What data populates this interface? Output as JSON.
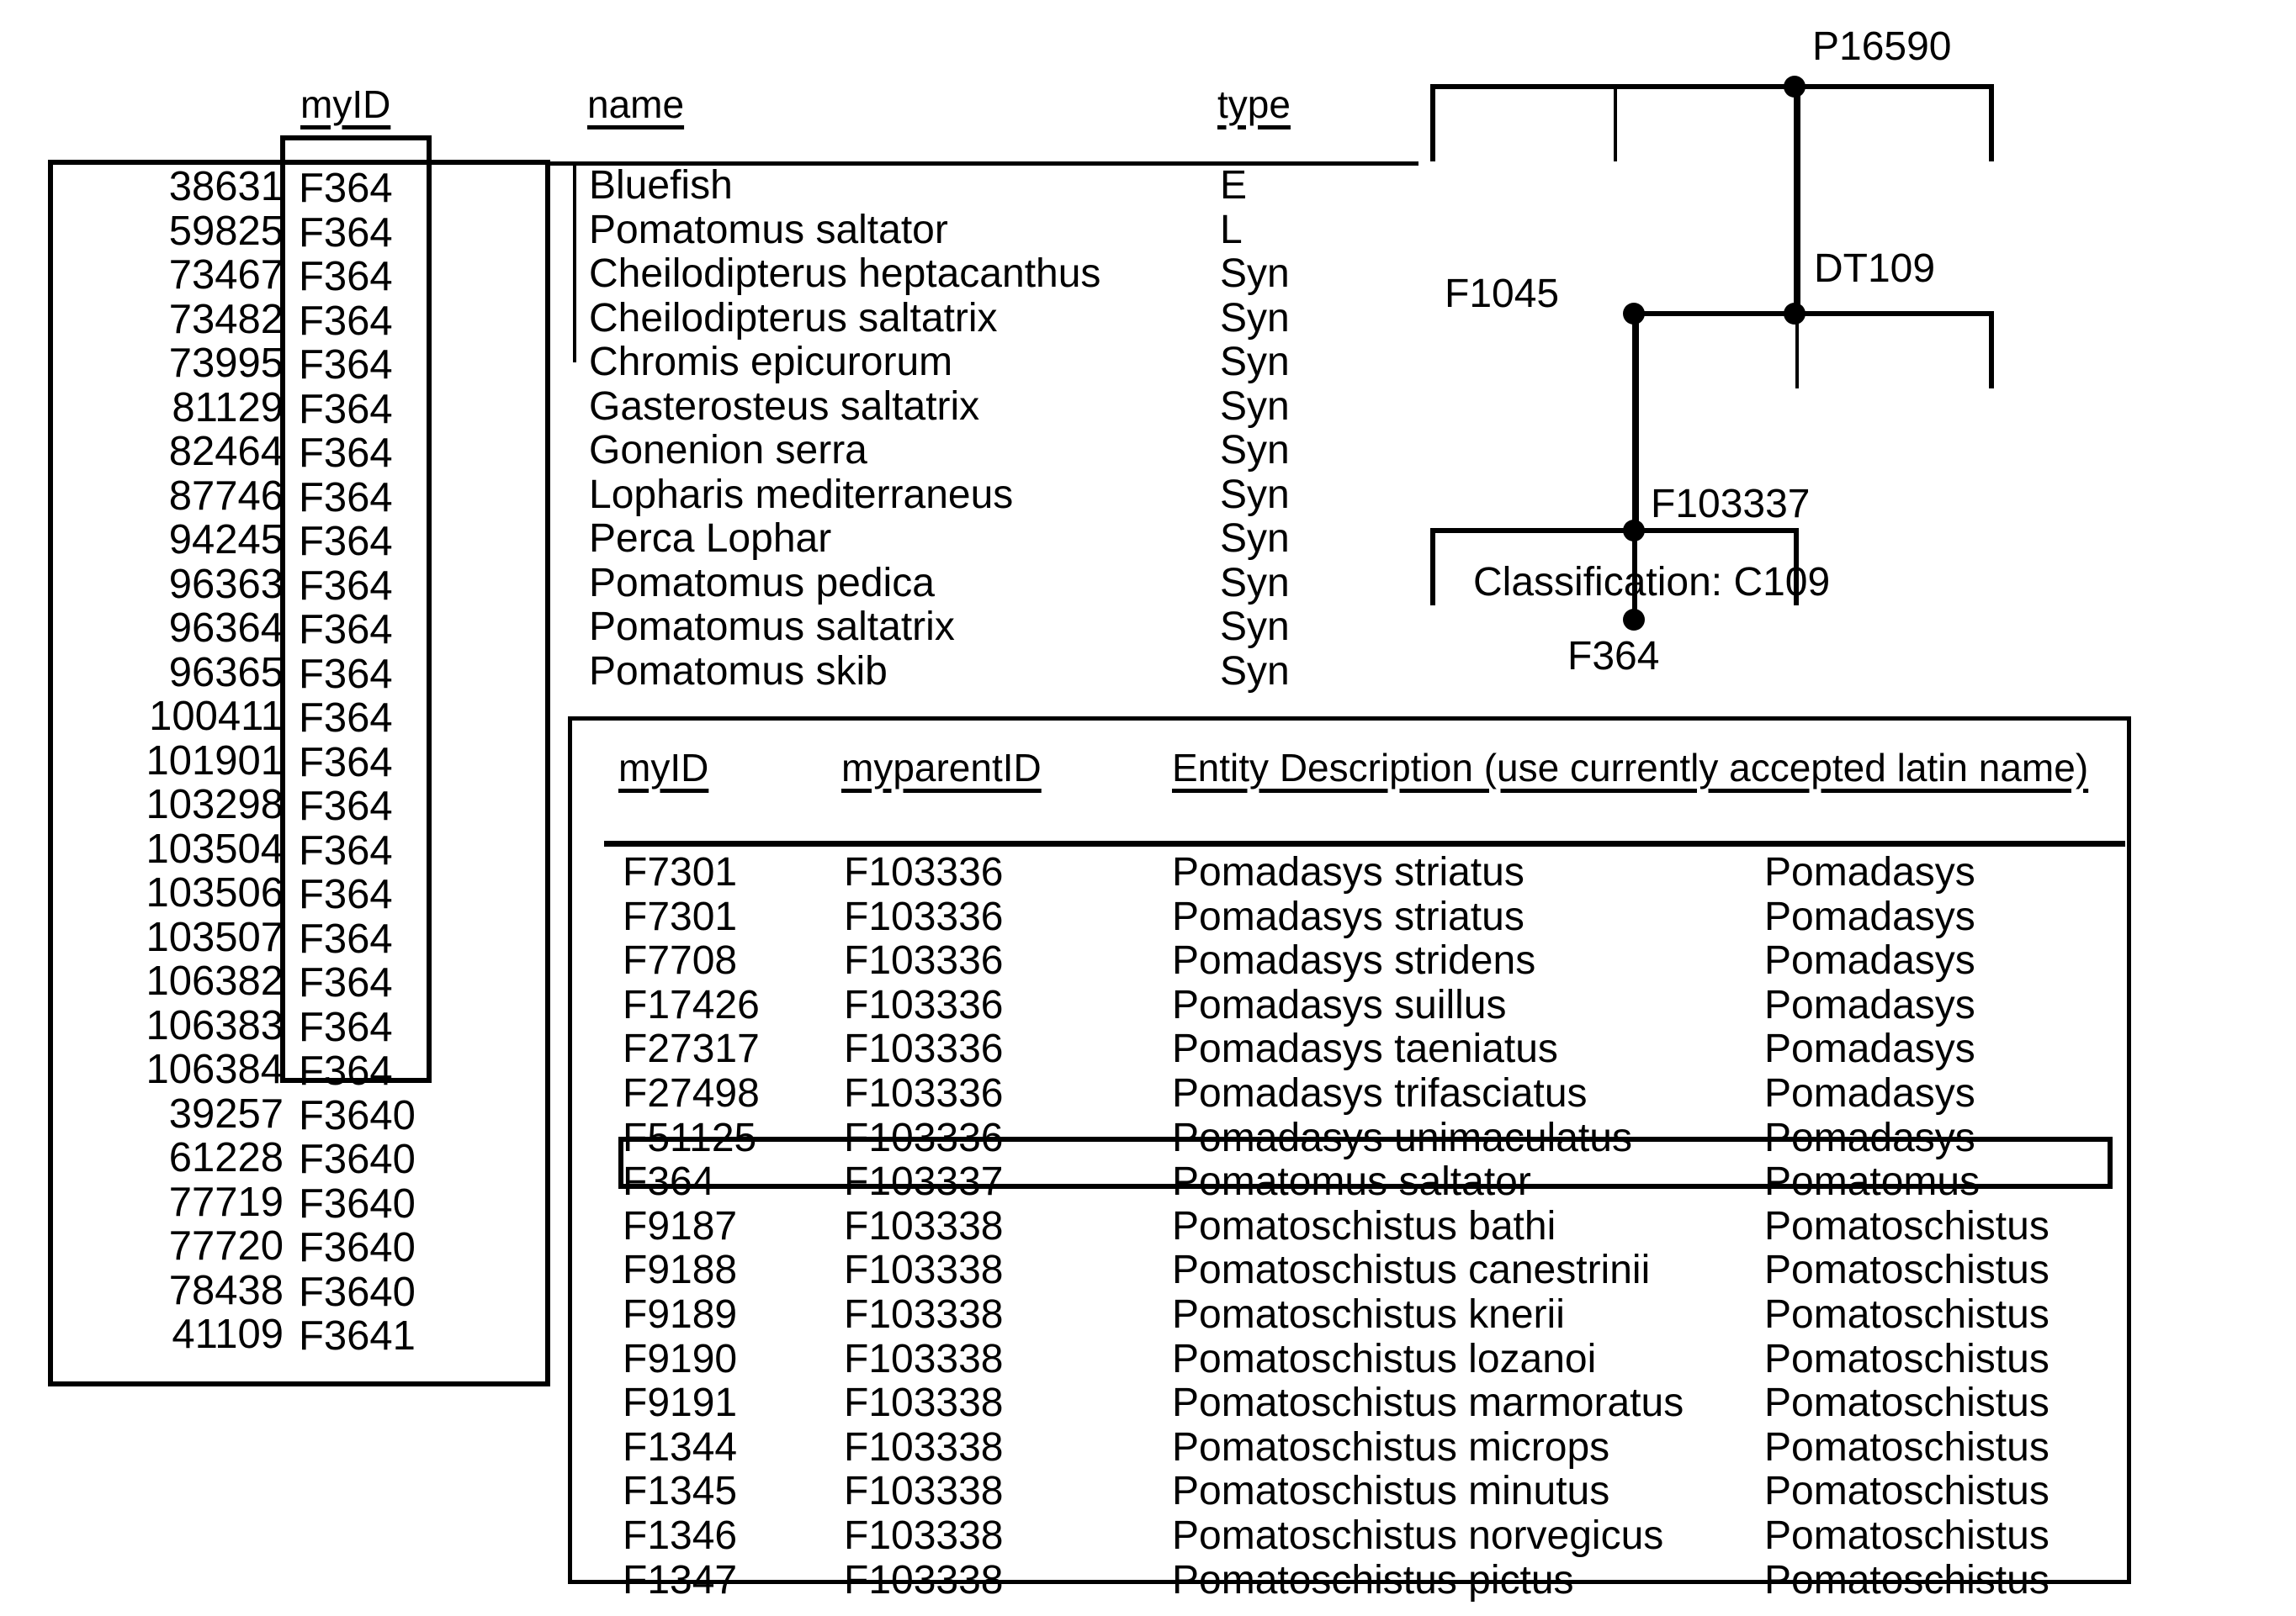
{
  "left_panel": {
    "rows": [
      {
        "num": "38631",
        "id": "F364"
      },
      {
        "num": "59825",
        "id": "F364"
      },
      {
        "num": "73467",
        "id": "F364"
      },
      {
        "num": "73482",
        "id": "F364"
      },
      {
        "num": "73995",
        "id": "F364"
      },
      {
        "num": "81129",
        "id": "F364"
      },
      {
        "num": "82464",
        "id": "F364"
      },
      {
        "num": "87746",
        "id": "F364"
      },
      {
        "num": "94245",
        "id": "F364"
      },
      {
        "num": "96363",
        "id": "F364"
      },
      {
        "num": "96364",
        "id": "F364"
      },
      {
        "num": "96365",
        "id": "F364"
      },
      {
        "num": "100411",
        "id": "F364"
      },
      {
        "num": "101901",
        "id": "F364"
      },
      {
        "num": "103298",
        "id": "F364"
      },
      {
        "num": "103504",
        "id": "F364"
      },
      {
        "num": "103506",
        "id": "F364"
      },
      {
        "num": "103507",
        "id": "F364"
      },
      {
        "num": "106382",
        "id": "F364"
      },
      {
        "num": "106383",
        "id": "F364"
      },
      {
        "num": "106384",
        "id": "F364"
      },
      {
        "num": "39257",
        "id": "F3640"
      },
      {
        "num": "61228",
        "id": "F3640"
      },
      {
        "num": "77719",
        "id": "F3640"
      },
      {
        "num": "77720",
        "id": "F3640"
      },
      {
        "num": "78438",
        "id": "F3640"
      },
      {
        "num": "41109",
        "id": "F3641"
      }
    ]
  },
  "top_table": {
    "headers": {
      "myid": "myID",
      "name": "name",
      "type": "type"
    },
    "rows": [
      {
        "name": "Bluefish",
        "type": "E"
      },
      {
        "name": "Pomatomus saltator",
        "type": "L"
      },
      {
        "name": "Cheilodipterus heptacanthus",
        "type": "Syn"
      },
      {
        "name": "Cheilodipterus saltatrix",
        "type": "Syn"
      },
      {
        "name": "Chromis epicurorum",
        "type": "Syn"
      },
      {
        "name": "Gasterosteus saltatrix",
        "type": "Syn"
      },
      {
        "name": "Gonenion serra",
        "type": "Syn"
      },
      {
        "name": "Lopharis mediterraneus",
        "type": "Syn"
      },
      {
        "name": "Perca Lophar",
        "type": "Syn"
      },
      {
        "name": "Pomatomus pedica",
        "type": "Syn"
      },
      {
        "name": "Pomatomus saltatrix",
        "type": "Syn"
      },
      {
        "name": "Pomatomus skib",
        "type": "Syn"
      }
    ]
  },
  "tree": {
    "nodes": {
      "p16590": "P16590",
      "dt109": "DT109",
      "f1045": "F1045",
      "f103337": "F103337",
      "f364": "F364"
    },
    "classification": "Classification: C109"
  },
  "bottom_table": {
    "headers": {
      "myid": "myID",
      "myparentid": "myparentID",
      "description": "Entity Description (use currently accepted latin name)"
    },
    "rows": [
      {
        "myid": "F7301",
        "parent": "F103336",
        "desc": "Pomadasys striatus",
        "genus": "Pomadasys",
        "clipped": true,
        "highlight": false
      },
      {
        "myid": "F7301",
        "parent": "F103336",
        "desc": "Pomadasys striatus",
        "genus": "Pomadasys",
        "clipped": false,
        "highlight": false
      },
      {
        "myid": "F7708",
        "parent": "F103336",
        "desc": "Pomadasys stridens",
        "genus": "Pomadasys",
        "clipped": false,
        "highlight": false
      },
      {
        "myid": "F17426",
        "parent": "F103336",
        "desc": "Pomadasys suillus",
        "genus": "Pomadasys",
        "clipped": false,
        "highlight": false
      },
      {
        "myid": "F27317",
        "parent": "F103336",
        "desc": "Pomadasys taeniatus",
        "genus": "Pomadasys",
        "clipped": false,
        "highlight": false
      },
      {
        "myid": "F27498",
        "parent": "F103336",
        "desc": "Pomadasys trifasciatus",
        "genus": "Pomadasys",
        "clipped": false,
        "highlight": false
      },
      {
        "myid": "F51125",
        "parent": "F103336",
        "desc": "Pomadasys unimaculatus",
        "genus": "Pomadasys",
        "clipped": false,
        "highlight": false
      },
      {
        "myid": "F364",
        "parent": "F103337",
        "desc": "Pomatomus saltator",
        "genus": "Pomatomus",
        "clipped": false,
        "highlight": true
      },
      {
        "myid": "F9187",
        "parent": "F103338",
        "desc": "Pomatoschistus bathi",
        "genus": "Pomatoschistus",
        "clipped": false,
        "highlight": false
      },
      {
        "myid": "F9188",
        "parent": "F103338",
        "desc": "Pomatoschistus canestrinii",
        "genus": "Pomatoschistus",
        "clipped": false,
        "highlight": false
      },
      {
        "myid": "F9189",
        "parent": "F103338",
        "desc": "Pomatoschistus knerii",
        "genus": "Pomatoschistus",
        "clipped": false,
        "highlight": false
      },
      {
        "myid": "F9190",
        "parent": "F103338",
        "desc": "Pomatoschistus lozanoi",
        "genus": "Pomatoschistus",
        "clipped": false,
        "highlight": false
      },
      {
        "myid": "F9191",
        "parent": "F103338",
        "desc": "Pomatoschistus marmoratus",
        "genus": "Pomatoschistus",
        "clipped": false,
        "highlight": false
      },
      {
        "myid": "F1344",
        "parent": "F103338",
        "desc": "Pomatoschistus microps",
        "genus": "Pomatoschistus",
        "clipped": false,
        "highlight": false
      },
      {
        "myid": "F1345",
        "parent": "F103338",
        "desc": "Pomatoschistus minutus",
        "genus": "Pomatoschistus",
        "clipped": false,
        "highlight": false
      },
      {
        "myid": "F1346",
        "parent": "F103338",
        "desc": "Pomatoschistus norvegicus",
        "genus": "Pomatoschistus",
        "clipped": false,
        "highlight": false
      },
      {
        "myid": "F1347",
        "parent": "F103338",
        "desc": "Pomatoschistus pictus",
        "genus": "Pomatoschistus",
        "clipped": false,
        "highlight": false
      }
    ]
  },
  "colors": {
    "ink": "#000000",
    "paper": "#ffffff"
  }
}
